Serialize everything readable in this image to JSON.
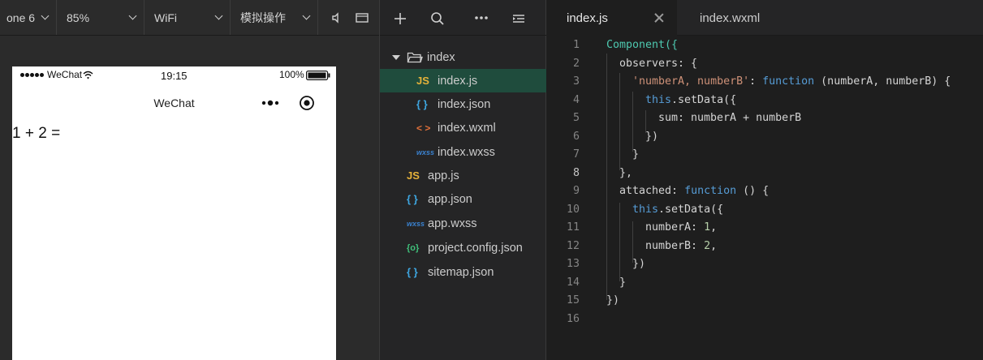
{
  "simulator": {
    "toolbar": {
      "device": "one 6",
      "zoom": "85%",
      "network": "WiFi",
      "operation": "模拟操作"
    },
    "status_bar": {
      "carrier": "WeChat",
      "time": "19:15",
      "battery": "100%"
    },
    "nav_bar": {
      "title": "WeChat"
    },
    "content": {
      "expression": "1 + 2 ="
    }
  },
  "explorer": {
    "tree": [
      {
        "label": "index",
        "icon": "folder-icon",
        "level": 0
      },
      {
        "label": "index.js",
        "icon": "js-file-icon",
        "level": 1,
        "selected": true
      },
      {
        "label": "index.json",
        "icon": "json-file-icon",
        "level": 1
      },
      {
        "label": "index.wxml",
        "icon": "wxml-file-icon",
        "level": 1
      },
      {
        "label": "index.wxss",
        "icon": "wxss-file-icon",
        "level": 1
      },
      {
        "label": "app.js",
        "icon": "js-file-icon",
        "level": 0
      },
      {
        "label": "app.json",
        "icon": "json-file-icon",
        "level": 0
      },
      {
        "label": "app.wxss",
        "icon": "wxss-file-icon",
        "level": 0
      },
      {
        "label": "project.config.json",
        "icon": "config-file-icon",
        "level": 0
      },
      {
        "label": "sitemap.json",
        "icon": "json-file-icon",
        "level": 0
      }
    ],
    "icon_glyphs": {
      "js": "JS",
      "json": "{ }",
      "wxml": "< >",
      "wxss": "wxss",
      "config": "{o}"
    }
  },
  "editor": {
    "tabs": [
      {
        "label": "index.js",
        "active": true
      },
      {
        "label": "index.wxml",
        "active": false
      }
    ],
    "current_line": 8,
    "lines": [
      {
        "n": "1",
        "text": "Component({"
      },
      {
        "n": "2",
        "text": "observers: {"
      },
      {
        "n": "3",
        "text": "'numberA, numberB': function (numberA, numberB) {"
      },
      {
        "n": "4",
        "text": "this.setData({"
      },
      {
        "n": "5",
        "text": "sum: numberA + numberB"
      },
      {
        "n": "6",
        "text": "})"
      },
      {
        "n": "7",
        "text": "}"
      },
      {
        "n": "8",
        "text": "},"
      },
      {
        "n": "9",
        "text": "attached: function () {"
      },
      {
        "n": "10",
        "text": "this.setData({"
      },
      {
        "n": "11",
        "text": "numberA: 1,"
      },
      {
        "n": "12",
        "text": "numberB: 2,"
      },
      {
        "n": "13",
        "text": "})"
      },
      {
        "n": "14",
        "text": "}"
      },
      {
        "n": "15",
        "text": "})"
      },
      {
        "n": "16",
        "text": ""
      }
    ]
  },
  "colors": {
    "selection": "#1f4c3d",
    "editor_bg": "#1e1e1e",
    "keyword": "#569cd6",
    "string": "#ce9178",
    "number": "#b5cea8",
    "function": "#4ec9b0"
  }
}
